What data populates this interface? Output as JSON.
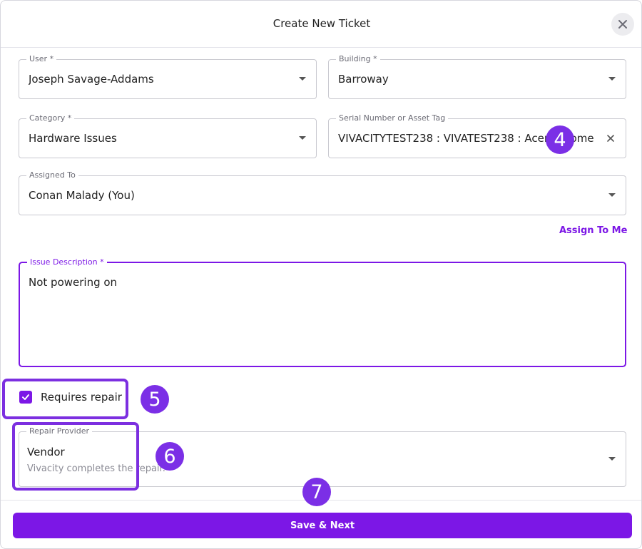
{
  "dialog": {
    "title": "Create New Ticket",
    "close_icon": "close-icon"
  },
  "fields": {
    "user": {
      "label": "User *",
      "value": "Joseph Savage-Addams"
    },
    "building": {
      "label": "Building *",
      "value": "Barroway"
    },
    "category": {
      "label": "Category *",
      "value": "Hardware Issues"
    },
    "serial": {
      "label": "Serial Number or Asset Tag",
      "value": "VIVACITYTEST238 : VIVATEST238 : Acer Chrome"
    },
    "assigned": {
      "label": "Assigned To",
      "value": "Conan Malady (You)"
    }
  },
  "assign_to_me": "Assign To Me",
  "issue_description": {
    "label": "Issue Description *",
    "value": "Not powering on"
  },
  "requires_repair": {
    "label": "Requires repair",
    "checked": true
  },
  "repair_provider": {
    "label": "Repair Provider",
    "value": "Vendor",
    "helper": "Vivacity completes the repair."
  },
  "save_button": "Save & Next",
  "step_markers": [
    "4",
    "5",
    "6",
    "7"
  ],
  "colors": {
    "accent": "#7c17e6",
    "marker": "#7b2fe6"
  }
}
